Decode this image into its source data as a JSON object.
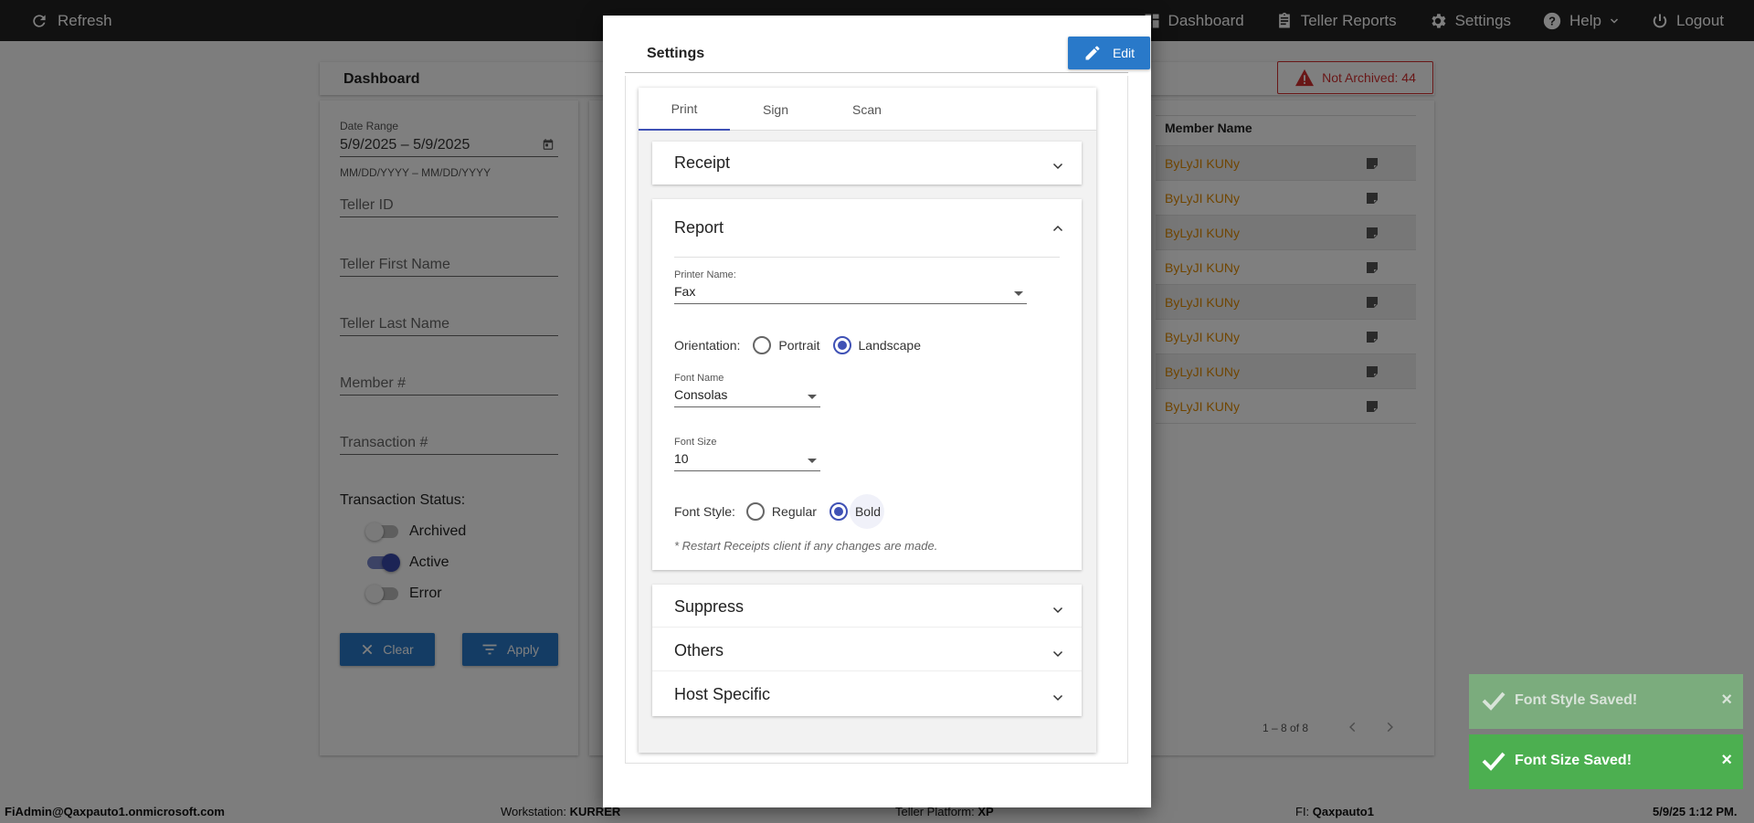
{
  "topbar": {
    "refresh_label": "Refresh",
    "nav": {
      "dashboard": "Dashboard",
      "teller_reports": "Teller Reports",
      "settings": "Settings",
      "help": "Help",
      "logout": "Logout"
    }
  },
  "dashboard": {
    "title": "Dashboard",
    "not_archived": "Not Archived: 44"
  },
  "filters": {
    "date_range_label": "Date Range",
    "date_range_value": "5/9/2025 – 5/9/2025",
    "date_format_hint": "MM/DD/YYYY – MM/DD/YYYY",
    "teller_id": "Teller ID",
    "teller_first_name": "Teller First Name",
    "teller_last_name": "Teller Last Name",
    "member_number": "Member #",
    "transaction_number": "Transaction #",
    "transaction_status_label": "Transaction Status:",
    "status_toggles": [
      {
        "label": "Archived",
        "on": false
      },
      {
        "label": "Active",
        "on": true
      },
      {
        "label": "Error",
        "on": false
      }
    ],
    "clear_label": "Clear",
    "apply_label": "Apply"
  },
  "table": {
    "column_member_name": "Member Name",
    "rows": [
      "ByLyJI KUNy",
      "ByLyJI KUNy",
      "ByLyJI KUNy",
      "ByLyJI KUNy",
      "ByLyJI KUNy",
      "ByLyJI KUNy",
      "ByLyJI KUNy",
      "ByLyJI KUNy"
    ],
    "pagination": "1 – 8 of 8"
  },
  "statusbar": {
    "user": "FiAdmin@Qaxpauto1.onmicrosoft.com",
    "workstation_label": "Workstation:",
    "workstation_value": "KURRER",
    "platform_label": "Teller Platform:",
    "platform_value": "XP",
    "fi_label": "FI:",
    "fi_value": "Qaxpauto1",
    "datetime": "5/9/25 1:12 PM."
  },
  "modal": {
    "title": "Settings",
    "edit_label": "Edit",
    "tabs": [
      "Print",
      "Sign",
      "Scan"
    ],
    "active_tab": "Print",
    "sections": {
      "receipt": "Receipt",
      "report": "Report",
      "suppress": "Suppress",
      "others": "Others",
      "host_specific": "Host Specific"
    },
    "report": {
      "printer_name_label": "Printer Name:",
      "printer_name_value": "Fax",
      "orientation_label": "Orientation:",
      "orientation_options": [
        "Portrait",
        "Landscape"
      ],
      "orientation_selected": "Landscape",
      "font_name_label": "Font Name",
      "font_name_value": "Consolas",
      "font_size_label": "Font Size",
      "font_size_value": "10",
      "font_style_label": "Font Style:",
      "font_style_options": [
        "Regular",
        "Bold"
      ],
      "font_style_selected": "Bold",
      "note": "* Restart Receipts client if any changes are made."
    }
  },
  "toasts": [
    {
      "text": "Font Style Saved!",
      "close": "×"
    },
    {
      "text": "Font Size Saved!",
      "close": "×"
    }
  ],
  "colors": {
    "accent": "#2979c9",
    "indigo": "#3f51b5",
    "warning": "#d32f2f",
    "link_orange": "#e08a00",
    "success": "#4caf50"
  }
}
